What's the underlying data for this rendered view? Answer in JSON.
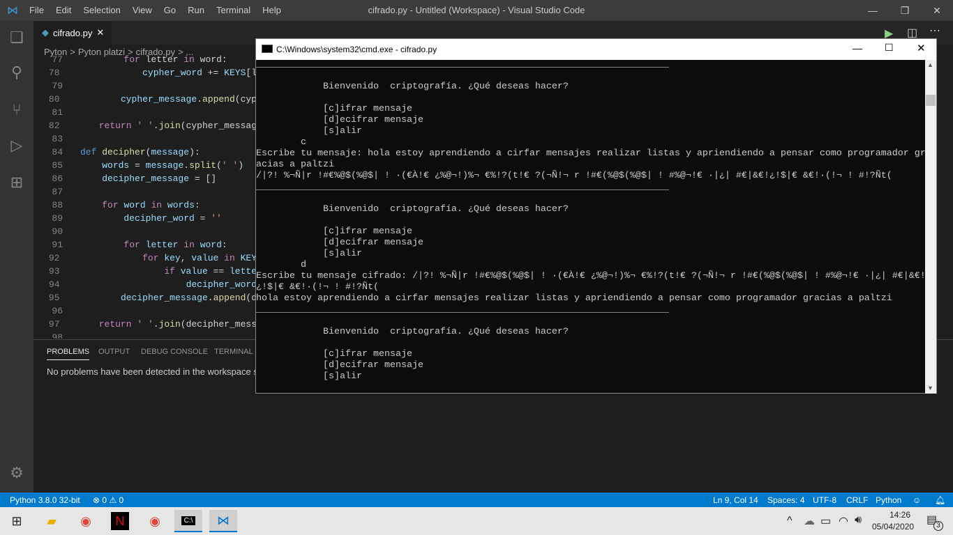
{
  "vscode": {
    "menu": [
      "File",
      "Edit",
      "Selection",
      "View",
      "Go",
      "Run",
      "Terminal",
      "Help"
    ],
    "title": "cifrado.py - Untitled (Workspace) - Visual Studio Code",
    "tab": "cifrado.py",
    "breadcrumb": [
      "Pyton",
      ">",
      "Pyton platzi",
      ">",
      "cifrado.py",
      ">",
      "..."
    ],
    "code": [
      {
        "n": "77",
        "t": [
          [
            "        "
          ],
          [
            "for",
            "kw"
          ],
          [
            " letter "
          ],
          [
            "in",
            "kw"
          ],
          [
            " word:"
          ]
        ]
      },
      {
        "n": "78",
        "t": [
          [
            "            "
          ],
          [
            "cypher_word",
            "vr"
          ],
          [
            " += "
          ],
          [
            "KEYS",
            "vr"
          ],
          [
            "[l"
          ]
        ]
      },
      {
        "n": "79",
        "t": [
          [
            ""
          ]
        ]
      },
      {
        "n": "80",
        "t": [
          [
            "        "
          ],
          [
            "cypher_message",
            "vr"
          ],
          [
            "."
          ],
          [
            "append",
            "fn"
          ],
          [
            "(cyp"
          ]
        ]
      },
      {
        "n": "81",
        "t": [
          [
            ""
          ]
        ]
      },
      {
        "n": "82",
        "t": [
          [
            "    "
          ],
          [
            "return",
            "kw"
          ],
          [
            " "
          ],
          [
            "' '",
            "st"
          ],
          [
            "."
          ],
          [
            "join",
            "fn"
          ],
          [
            "(cypher_messag"
          ]
        ]
      },
      {
        "n": "83",
        "t": [
          [
            ""
          ]
        ]
      },
      {
        "n": "84",
        "t": [
          [
            "def",
            "df"
          ],
          [
            " "
          ],
          [
            "decipher",
            "fn"
          ],
          [
            "("
          ],
          [
            "message",
            "vr"
          ],
          [
            "):"
          ]
        ]
      },
      {
        "n": "85",
        "t": [
          [
            "    "
          ],
          [
            "words",
            "vr"
          ],
          [
            " = "
          ],
          [
            "message",
            "vr"
          ],
          [
            "."
          ],
          [
            "split",
            "fn"
          ],
          [
            "("
          ],
          [
            "' '",
            "st"
          ],
          [
            ")"
          ]
        ]
      },
      {
        "n": "86",
        "t": [
          [
            "    "
          ],
          [
            "decipher_message",
            "vr"
          ],
          [
            " = []"
          ]
        ]
      },
      {
        "n": "87",
        "t": [
          [
            ""
          ]
        ]
      },
      {
        "n": "88",
        "t": [
          [
            "    "
          ],
          [
            "for",
            "kw"
          ],
          [
            " "
          ],
          [
            "word",
            "vr"
          ],
          [
            " "
          ],
          [
            "in",
            "kw"
          ],
          [
            " "
          ],
          [
            "words",
            "vr"
          ],
          [
            ":"
          ]
        ]
      },
      {
        "n": "89",
        "t": [
          [
            "        "
          ],
          [
            "decipher_word",
            "vr"
          ],
          [
            " = "
          ],
          [
            "''",
            "st"
          ]
        ]
      },
      {
        "n": "90",
        "t": [
          [
            ""
          ]
        ]
      },
      {
        "n": "91",
        "t": [
          [
            "        "
          ],
          [
            "for",
            "kw"
          ],
          [
            " "
          ],
          [
            "letter",
            "vr"
          ],
          [
            " "
          ],
          [
            "in",
            "kw"
          ],
          [
            " "
          ],
          [
            "word",
            "vr"
          ],
          [
            ":"
          ]
        ]
      },
      {
        "n": "92",
        "t": [
          [
            "            "
          ],
          [
            "for",
            "kw"
          ],
          [
            " "
          ],
          [
            "key",
            "vr"
          ],
          [
            ", "
          ],
          [
            "value",
            "vr"
          ],
          [
            " "
          ],
          [
            "in",
            "kw"
          ],
          [
            " "
          ],
          [
            "KEY",
            "vr"
          ]
        ]
      },
      {
        "n": "93",
        "t": [
          [
            "                "
          ],
          [
            "if",
            "kw"
          ],
          [
            " "
          ],
          [
            "value",
            "vr"
          ],
          [
            " == "
          ],
          [
            "lette",
            "vr"
          ]
        ]
      },
      {
        "n": "94",
        "t": [
          [
            "                    "
          ],
          [
            "decipher_word",
            "vr"
          ]
        ]
      },
      {
        "n": "95",
        "t": [
          [
            "        "
          ],
          [
            "decipher_message",
            "vr"
          ],
          [
            "."
          ],
          [
            "append",
            "fn"
          ],
          [
            "(d"
          ]
        ]
      },
      {
        "n": "96",
        "t": [
          [
            ""
          ]
        ]
      },
      {
        "n": "97",
        "t": [
          [
            "    "
          ],
          [
            "return",
            "kw"
          ],
          [
            " "
          ],
          [
            "' '",
            "st"
          ],
          [
            "."
          ],
          [
            "join",
            "fn"
          ],
          [
            "(decipher_mess"
          ]
        ]
      },
      {
        "n": "98",
        "t": [
          [
            ""
          ]
        ]
      }
    ],
    "panel": {
      "tabs": [
        "PROBLEMS",
        "OUTPUT",
        "DEBUG CONSOLE",
        "TERMINAL"
      ],
      "message": "No problems have been detected in the workspace s"
    },
    "status": {
      "python": "Python 3.8.0 32-bit",
      "problems": "⊗ 0 ⚠ 0",
      "position": "Ln 9, Col 14",
      "spaces": "Spaces: 4",
      "encoding": "UTF-8",
      "eol": "CRLF",
      "language": "Python"
    }
  },
  "cmd": {
    "title": "C:\\Windows\\system32\\cmd.exe - cifrado.py",
    "lines": [
      "__________________________________________________________________________",
      "",
      "            Bienvenido  criptografía. ¿Qué deseas hacer?",
      "",
      "            [c]ifrar mensaje",
      "            [d]ecifrar mensaje",
      "            [s]alir",
      "        c",
      "Escribe tu mensaje: hola estoy aprendiendo a cirfar mensajes realizar listas y apriendiendo a pensar como programador gr",
      "acias a paltzi",
      "/|?! %¬Ñ|r !#€%@$(%@$| ! ·(€À!€ ¿%@¬!)%¬ €%!?(t!€ ?(¬Ñ!¬ r !#€(%@$(%@$| ! #%@¬!€ ·|¿| #€|&€!¿!$|€ &€!·(!¬ ! #!?Ñt(",
      "__________________________________________________________________________",
      "",
      "            Bienvenido  criptografía. ¿Qué deseas hacer?",
      "",
      "            [c]ifrar mensaje",
      "            [d]ecifrar mensaje",
      "            [s]alir",
      "        d",
      "Escribe tu mensaje cifrado: /|?! %¬Ñ|r !#€%@$(%@$| ! ·(€À!€ ¿%@¬!)%¬ €%!?(t!€ ?(¬Ñ!¬ r !#€(%@$(%@$| ! #%@¬!€ ·|¿| #€|&€!",
      "¿!$|€ &€!·(!¬ ! #!?Ñt(",
      "hola estoy aprendiendo a cirfar mensajes realizar listas y apriendiendo a pensar como programador gracias a paltzi",
      "__________________________________________________________________________",
      "",
      "            Bienvenido  criptografía. ¿Qué deseas hacer?",
      "",
      "            [c]ifrar mensaje",
      "            [d]ecifrar mensaje",
      "            [s]alir",
      "",
      "            _"
    ]
  },
  "taskbar": {
    "time": "14:26",
    "date": "05/04/2020",
    "notifications": "3"
  }
}
